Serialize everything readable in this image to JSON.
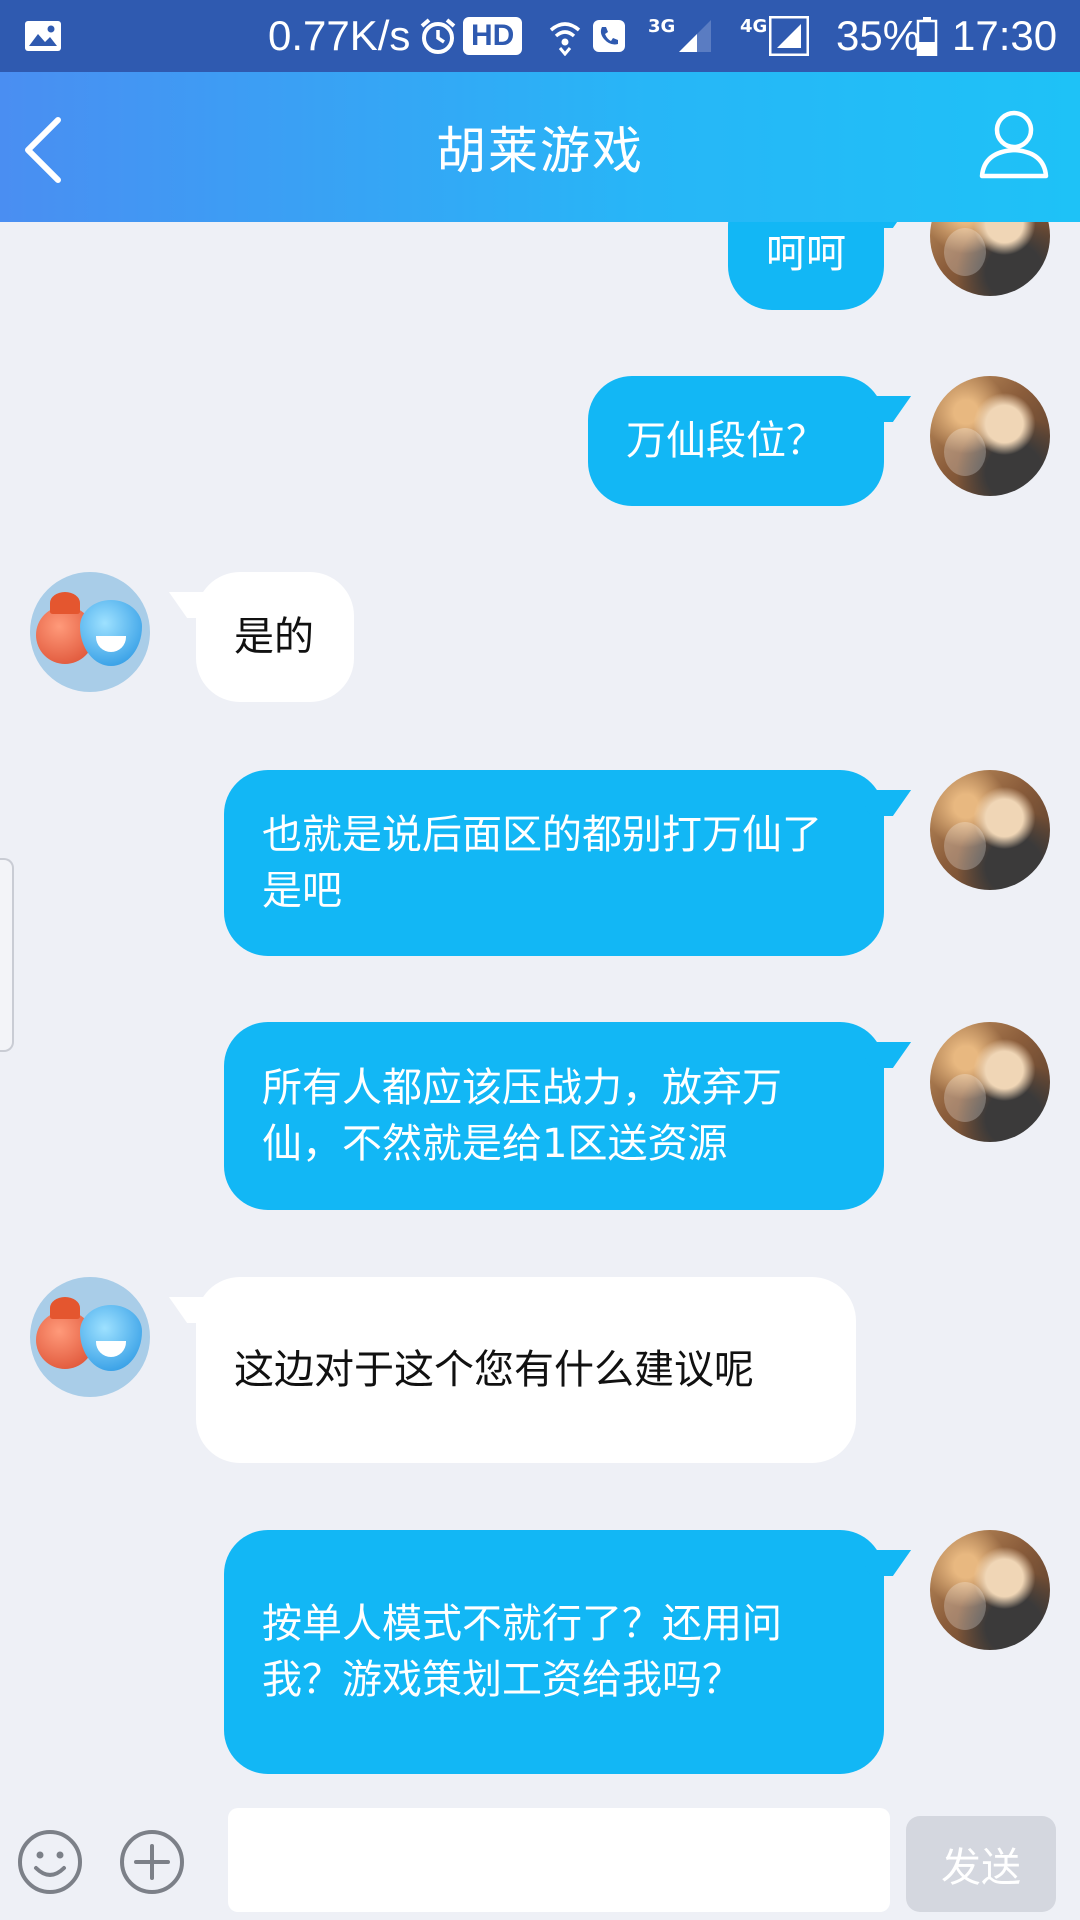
{
  "status_bar": {
    "net_speed": "0.77K/s",
    "hd_label": "HD",
    "net1_label": "3G",
    "net2_label": "4G",
    "battery_percent": "35%",
    "time": "17:30"
  },
  "header": {
    "title": "胡莱游戏"
  },
  "messages": [
    {
      "sender": "me",
      "text": "呵呵"
    },
    {
      "sender": "me",
      "text": "万仙段位？"
    },
    {
      "sender": "them",
      "text": "是的"
    },
    {
      "sender": "me",
      "text": "也就是说后面区的都别打万仙了是吧"
    },
    {
      "sender": "me",
      "text": "所有人都应该压战力，放弃万仙，不然就是给1区送资源"
    },
    {
      "sender": "them",
      "text": "这边对于这个您有什么建议呢"
    },
    {
      "sender": "me",
      "text": "按单人模式不就行了？还用问我？游戏策划工资给我吗？"
    }
  ],
  "input_bar": {
    "input_value": "",
    "send_label": "发送"
  },
  "colors": {
    "status_bar": "#2f5ab0",
    "header_gradient_start": "#4a8ef2",
    "header_gradient_end": "#1ec2f7",
    "my_bubble": "#12b7f5",
    "their_bubble": "#ffffff",
    "background": "#eef0f6"
  },
  "icons": [
    "gallery-icon",
    "alarm-icon",
    "wifi-icon",
    "call-icon",
    "signal-icon",
    "battery-icon",
    "back-arrow-icon",
    "profile-icon",
    "emoji-icon",
    "plus-circle-icon"
  ]
}
